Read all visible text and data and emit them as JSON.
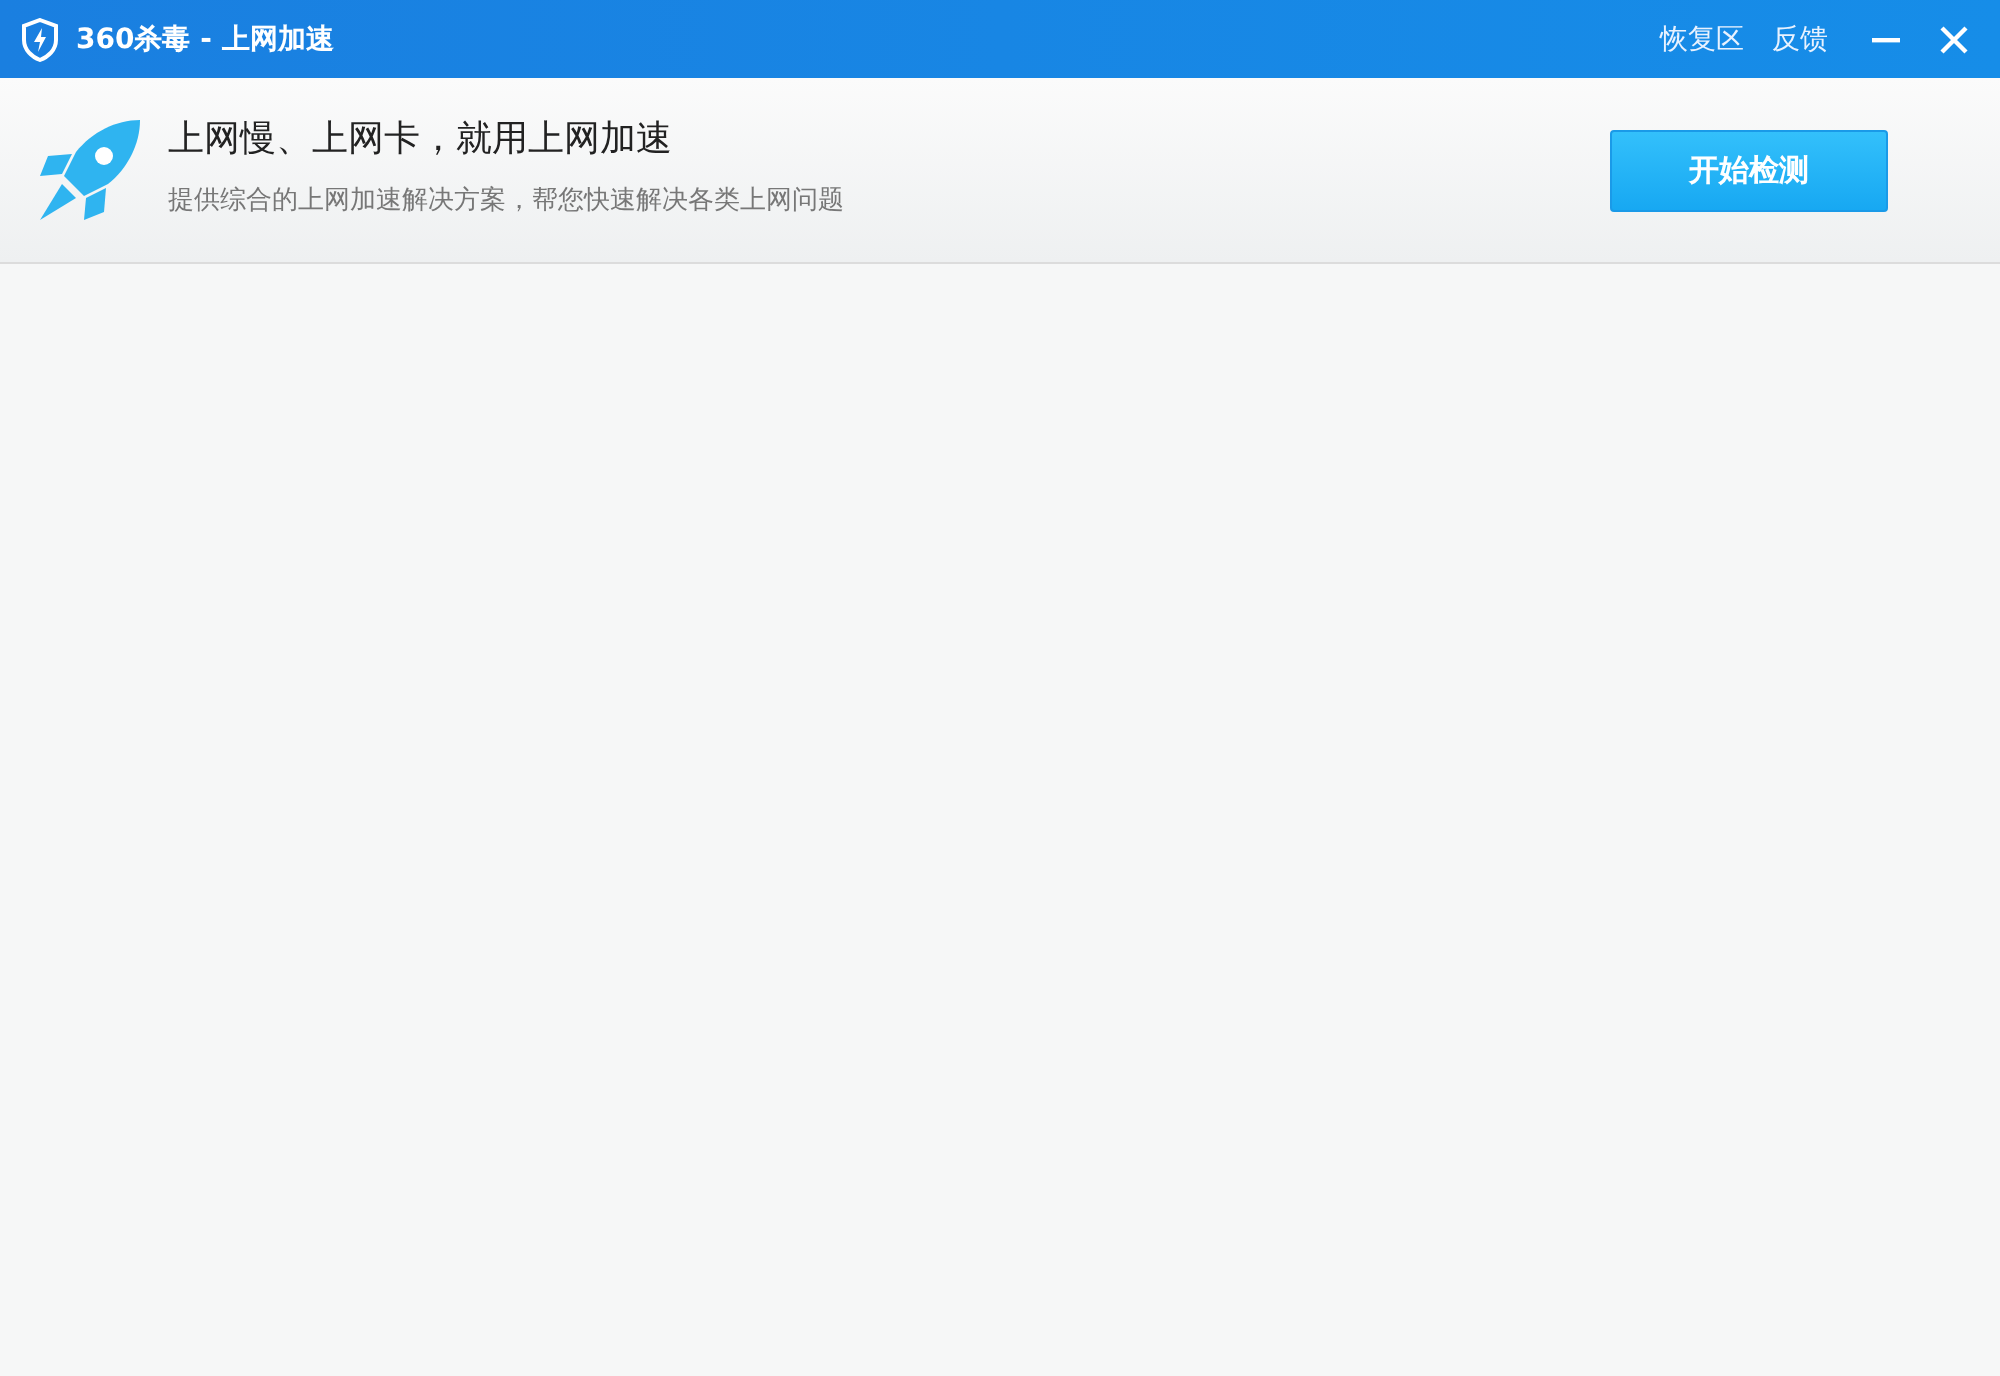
{
  "window": {
    "title": "360杀毒 - 上网加速",
    "links": [
      "恢复区",
      "反馈"
    ]
  },
  "header": {
    "headline": "上网慢、上网卡，就用上网加速",
    "description": "提供综合的上网加速解决方案，帮您快速解决各类上网问题",
    "button": "开始检测"
  }
}
